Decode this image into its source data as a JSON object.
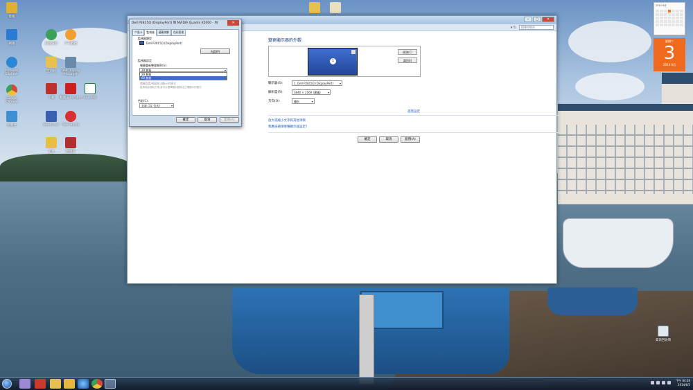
{
  "desktop": {
    "icons": [
      {
        "label": "電腦",
        "color": "#e0b030"
      },
      {
        "label": "網路",
        "color": "#2b7bd4"
      },
      {
        "label": "Internet Explorer",
        "color": "#2a87d6"
      },
      {
        "label": "Google Chrome",
        "color": "#d44a3a"
      },
      {
        "label": "控制台",
        "color": "#3e8fd1"
      },
      {
        "label": "好好好好",
        "color": "#3aa05a"
      },
      {
        "label": "千千靜聽",
        "color": "#f0a030"
      },
      {
        "label": "王道精",
        "color": "#e8c050"
      },
      {
        "label": "Dell Display Manager",
        "color": "#6a8aaa"
      },
      {
        "label": "下載",
        "color": "#c0302a"
      },
      {
        "label": "看圖王 Acrobat",
        "color": "#cc2020"
      },
      {
        "label": "Excel 檔",
        "color": "#1f7a3a"
      },
      {
        "label": "Bandicam",
        "color": "#3a5fb0"
      },
      {
        "label": "Tobi Studio",
        "color": "#d83030"
      },
      {
        "label": "工具",
        "color": "#e8c040"
      },
      {
        "label": "翻譯王",
        "color": "#b03030"
      },
      {
        "label": "資料夾",
        "color": "#e8c050"
      },
      {
        "label": "文件",
        "color": "#e8e0c0"
      }
    ],
    "recycle_bin": "資源回收筒"
  },
  "calendar_widget": {
    "month": "2014 6月",
    "weekday": "星期二",
    "day": "3",
    "year_month": "2014 6月"
  },
  "main_window": {
    "search_placeholder": "搜尋控制台",
    "heading": "變更顯示器的外觀",
    "detect_button": "偵測(C)",
    "identify_button": "識別(I)",
    "monitor_number": "1",
    "display_label": "顯示器(S):",
    "display_value": "1. Dell P2815Q (DisplayPort)",
    "resolution_label": "解析度(R):",
    "resolution_value": "3840 × 2160 (建議)",
    "orientation_label": "方向(O):",
    "orientation_value": "橫向",
    "advanced_link": "進階設定",
    "link1": "放大或縮小文字和其他項目",
    "link2": "我應該選擇哪種顯示器設定?",
    "ok_button": "確定",
    "cancel_button": "取消",
    "apply_button": "套用(A)"
  },
  "dialog": {
    "title": "Dell P2815Q (DisplayPort) 和 NVIDIA Quadro K5000 - 內容",
    "tabs": [
      "介面卡",
      "監視器",
      "疑難排解",
      "色彩管理"
    ],
    "monitor_type_label": "監視器類型",
    "monitor_name": "Dell P2815Q (DisplayPort)",
    "properties_button": "內容(P)",
    "monitor_settings_label": "監視器設定",
    "refresh_label": "螢幕重新整理頻率(S):",
    "refresh_options": [
      "29 赫茲",
      "60 赫茲"
    ],
    "hint_line1": "隱藏此監視器無法顯示的模式",
    "hint_line2": "若清除此核取方塊,將可以選擇顯示器無法正確顯示的模式",
    "colors_label": "色彩(C):",
    "colors_value": "全彩 (32 位元)",
    "ok_button": "確定",
    "cancel_button": "取消",
    "apply_button": "套用(A)"
  },
  "taskbar": {
    "time": "下午 04:26",
    "date": "2014/6/3"
  }
}
